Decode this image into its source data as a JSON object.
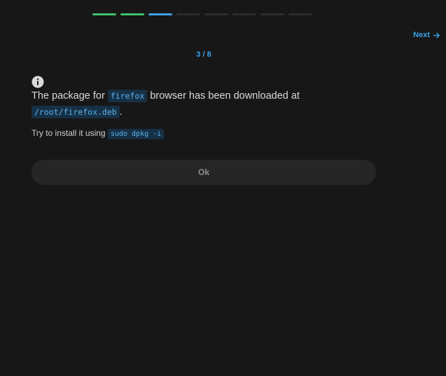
{
  "progress": {
    "total_steps": 8,
    "completed_steps": 2,
    "current_step": 3,
    "colors": {
      "done": "#3ec26a",
      "current": "#3ba2e8",
      "pending": "#2c2c2c"
    }
  },
  "nav": {
    "next_label": "Next",
    "next_icon": "arrow-right-icon"
  },
  "step_counter": "3 / 8",
  "message": {
    "icon": "info-icon",
    "prefix": "The package for ",
    "package_name": "firefox",
    "middle": " browser has been downloaded at ",
    "path": "/root/firefox.deb",
    "suffix": "."
  },
  "hint": {
    "text": "Try to install it using ",
    "command": "sudo dpkg -i"
  },
  "ok_button": {
    "label": "Ok"
  },
  "colors": {
    "accent": "#3ba2e8",
    "background": "#171717",
    "code_bg": "#163045"
  }
}
